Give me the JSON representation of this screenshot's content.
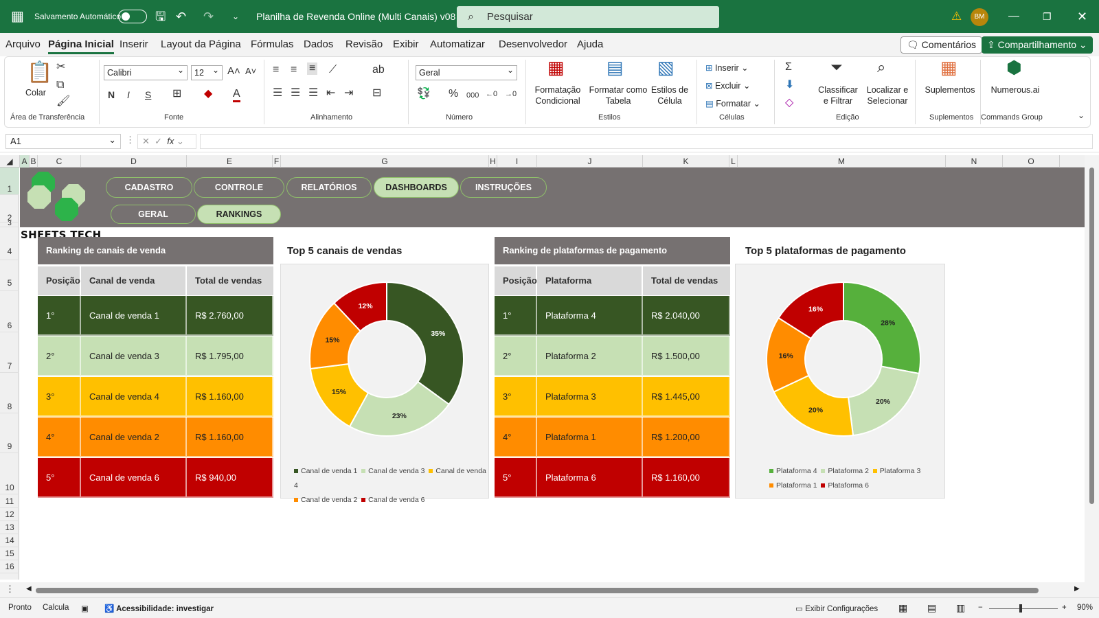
{
  "titlebar": {
    "autosave_label": "Salvamento Automático",
    "file_title": "Planilha de Revenda Online (Multi Canais) v08",
    "search_placeholder": "Pesquisar",
    "user_initials": "BM"
  },
  "menu": {
    "items": [
      "Arquivo",
      "Página Inicial",
      "Inserir",
      "Layout da Página",
      "Fórmulas",
      "Dados",
      "Revisão",
      "Exibir",
      "Automatizar",
      "Desenvolvedor",
      "Ajuda"
    ],
    "comments": "Comentários",
    "share": "Compartilhamento"
  },
  "ribbon": {
    "clipboard": {
      "paste": "Colar",
      "group": "Área de Transferência"
    },
    "font": {
      "name": "Calibri",
      "size": "12",
      "group": "Fonte",
      "bold": "N",
      "italic": "I",
      "underline": "S"
    },
    "alignment": {
      "group": "Alinhamento"
    },
    "number": {
      "format": "Geral",
      "group": "Número"
    },
    "styles": {
      "conditional": "Formatação\nCondicional",
      "as_table": "Formatar como\nTabela",
      "cell_styles": "Estilos de\nCélula",
      "group": "Estilos"
    },
    "cells": {
      "insert": "Inserir",
      "delete": "Excluir",
      "format": "Formatar",
      "group": "Células"
    },
    "editing": {
      "sort": "Classificar\ne Filtrar",
      "find": "Localizar e\nSelecionar",
      "group": "Edição"
    },
    "addins": {
      "label": "Suplementos",
      "group": "Suplementos"
    },
    "commands": {
      "label": "Numerous.ai",
      "group": "Commands Group"
    }
  },
  "formula": {
    "name_box": "A1",
    "fx": "fx"
  },
  "columns": [
    "A",
    "B",
    "C",
    "D",
    "E",
    "F",
    "G",
    "H",
    "I",
    "J",
    "K",
    "L",
    "M",
    "N",
    "O"
  ],
  "rows": [
    "1",
    "2",
    "3",
    "4",
    "5",
    "6",
    "7",
    "8",
    "9",
    "10",
    "11",
    "12",
    "13",
    "14",
    "15",
    "16"
  ],
  "nav": {
    "main": [
      "CADASTRO",
      "CONTROLE",
      "RELATÓRIOS",
      "DASHBOARDS",
      "INSTRUÇÕES"
    ],
    "sub": [
      "GERAL",
      "RANKINGS"
    ],
    "logo": "SHEETS TECH"
  },
  "ranking_channels": {
    "title": "Ranking de canais de venda",
    "headers": [
      "Posição",
      "Canal de venda",
      "Total de vendas"
    ],
    "rows": [
      [
        "1°",
        "Canal de venda 1",
        "R$ 2.760,00"
      ],
      [
        "2°",
        "Canal de venda 3",
        "R$ 1.795,00"
      ],
      [
        "3°",
        "Canal de venda 4",
        "R$ 1.160,00"
      ],
      [
        "4°",
        "Canal de venda 2",
        "R$ 1.160,00"
      ],
      [
        "5°",
        "Canal de venda 6",
        "R$ 940,00"
      ]
    ]
  },
  "ranking_platforms": {
    "title": "Ranking de plataformas de pagamento",
    "headers": [
      "Posição",
      "Plataforma",
      "Total de vendas"
    ],
    "rows": [
      [
        "1°",
        "Plataforma 4",
        "R$ 2.040,00"
      ],
      [
        "2°",
        "Plataforma 2",
        "R$ 1.500,00"
      ],
      [
        "3°",
        "Plataforma 3",
        "R$ 1.445,00"
      ],
      [
        "4°",
        "Plataforma 1",
        "R$ 1.200,00"
      ],
      [
        "5°",
        "Plataforma 6",
        "R$ 1.160,00"
      ]
    ]
  },
  "rank_colors": {
    "bg": [
      "#375623",
      "#c6e0b4",
      "#ffc000",
      "#ff8c00",
      "#c00000"
    ],
    "fg": [
      "#ffffff",
      "#222222",
      "#222222",
      "#222222",
      "#ffffff"
    ]
  },
  "chart_data": [
    {
      "type": "pie",
      "title": "Top 5 canais de vendas",
      "categories": [
        "Canal de venda 1",
        "Canal de venda 3",
        "Canal de venda 4",
        "Canal de venda 2",
        "Canal de venda 6"
      ],
      "values": [
        35,
        23,
        15,
        15,
        12
      ],
      "labels": [
        "35%",
        "23%",
        "15%",
        "15%",
        "12%"
      ],
      "colors": [
        "#375623",
        "#c6e0b4",
        "#ffc000",
        "#ff8c00",
        "#c00000"
      ],
      "legend": "bottom"
    },
    {
      "type": "pie",
      "title": "Top 5 plataformas de pagamento",
      "categories": [
        "Plataforma 4",
        "Plataforma 2",
        "Plataforma 3",
        "Plataforma 1",
        "Plataforma 6"
      ],
      "values": [
        28,
        20,
        20,
        16,
        16
      ],
      "labels": [
        "28%",
        "20%",
        "20%",
        "16%",
        "16%"
      ],
      "colors": [
        "#56b03c",
        "#c6e0b4",
        "#ffc000",
        "#ff8c00",
        "#c00000"
      ],
      "legend": "bottom"
    }
  ],
  "status": {
    "ready": "Pronto",
    "calc": "Calcula",
    "accessibility": "Acessibilidade: investigar",
    "display": "Exibir Configurações",
    "zoom": "90%"
  }
}
